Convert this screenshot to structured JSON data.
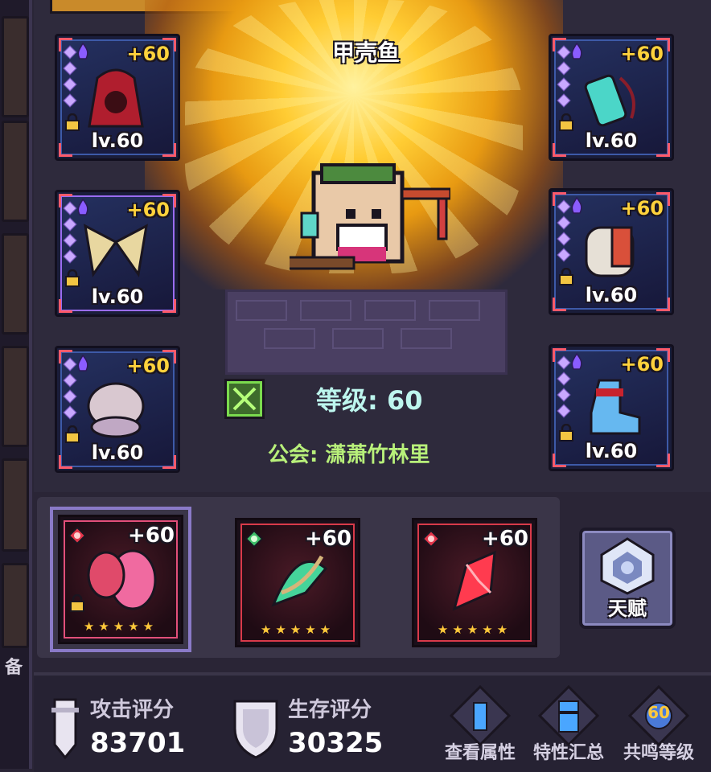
{
  "character": {
    "name": "甲壳鱼",
    "level_label": "等级: 60",
    "guild_label": "公会: 潇萧竹林里"
  },
  "gear_slots": [
    {
      "slot": "hood",
      "enhance": "+60",
      "level": "lv.60",
      "color": "#b01e2e"
    },
    {
      "slot": "wings",
      "enhance": "+60",
      "level": "lv.60",
      "color": "#e8d7a0"
    },
    {
      "slot": "armor",
      "enhance": "+60",
      "level": "lv.60",
      "color": "#d9c8d0"
    },
    {
      "slot": "potion",
      "enhance": "+60",
      "level": "lv.60",
      "color": "#4bd6c8"
    },
    {
      "slot": "bracer",
      "enhance": "+60",
      "level": "lv.60",
      "color": "#e6e0d6"
    },
    {
      "slot": "boots",
      "enhance": "+60",
      "level": "lv.60",
      "color": "#66b8f0"
    }
  ],
  "weapons": [
    {
      "enhance": "+60",
      "stars": 5,
      "element": "fire",
      "color": "#f06aa0"
    },
    {
      "enhance": "+60",
      "stars": 5,
      "element": "nature",
      "color": "#45d49a"
    },
    {
      "enhance": "+60",
      "stars": 5,
      "element": "fire",
      "color": "#ff3b4f"
    }
  ],
  "talent": {
    "label": "天赋"
  },
  "scores": {
    "attack_label": "攻击评分",
    "attack_value": "83701",
    "survival_label": "生存评分",
    "survival_value": "30325"
  },
  "quick_actions": {
    "view_attributes": "查看属性",
    "trait_summary": "特性汇总",
    "resonance_level": "共鸣等级",
    "resonance_badge": "60"
  },
  "left_strip": {
    "char": "备"
  },
  "colors": {
    "gold": "#ffd23c",
    "level_text": "#bdf6ee",
    "guild_text": "#b8f07a",
    "panel": "#2e2a3c"
  }
}
